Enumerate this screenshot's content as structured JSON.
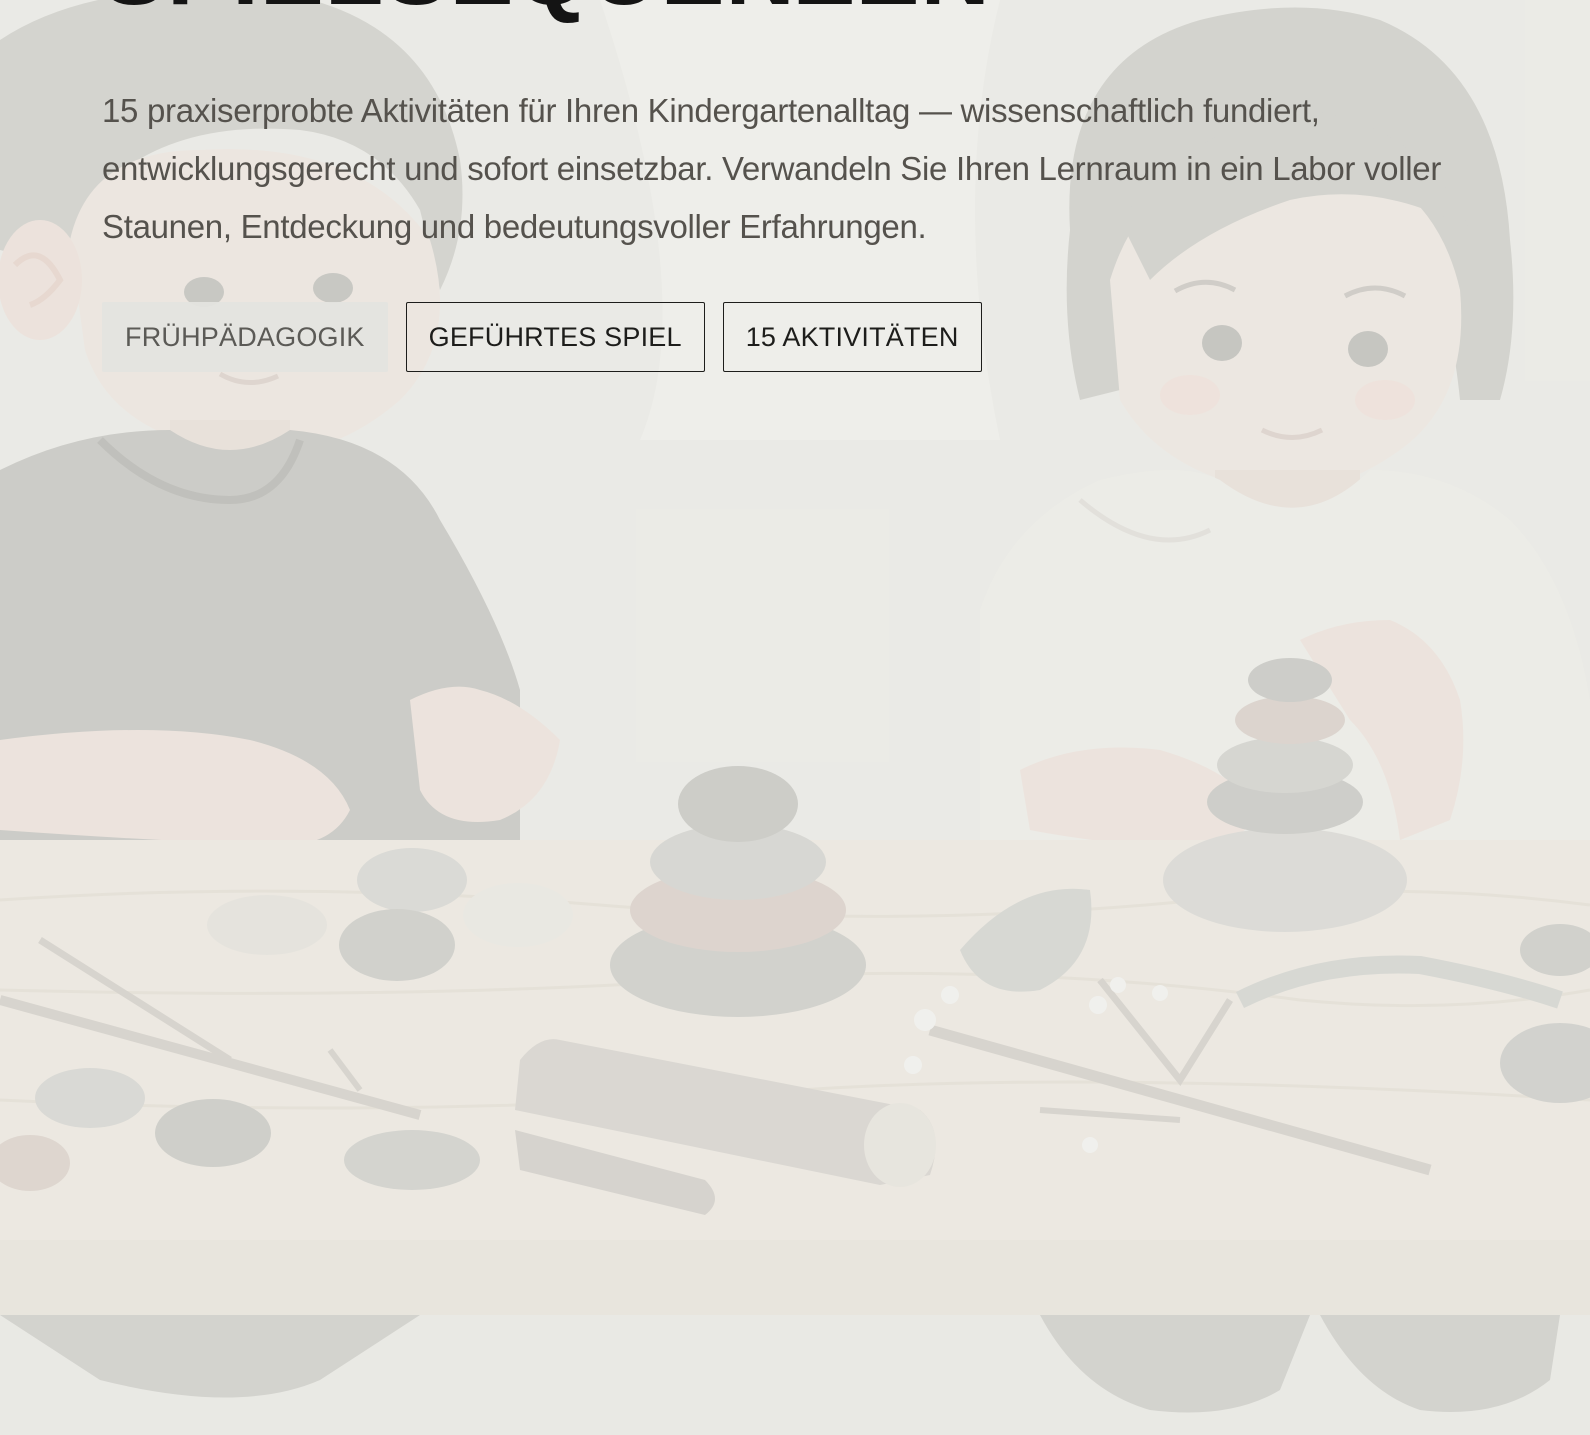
{
  "hero": {
    "title": "SPIELSEQUENZEN",
    "subtitle": "15 praxiserprobte Aktivitäten für Ihren Kindergartenalltag — wissenschaftlich fundiert, entwicklungsgerecht und sofort einsetzbar. Verwandeln Sie Ihren Lernraum in ein Labor voller Staunen, Entdeckung und bedeutungsvoller Erfahrungen.",
    "tags": [
      {
        "label": "FRÜHPÄDAGOGIK"
      },
      {
        "label": "GEFÜHRTES SPIEL"
      },
      {
        "label": "15 AKTIVITÄTEN"
      }
    ]
  },
  "colors": {
    "background": "#ebebe6",
    "text_primary": "#141414",
    "text_secondary": "#55524d",
    "tag_border": "#1d1d1b"
  },
  "background_image": {
    "icon": "children-stacking-stones-illustration"
  }
}
